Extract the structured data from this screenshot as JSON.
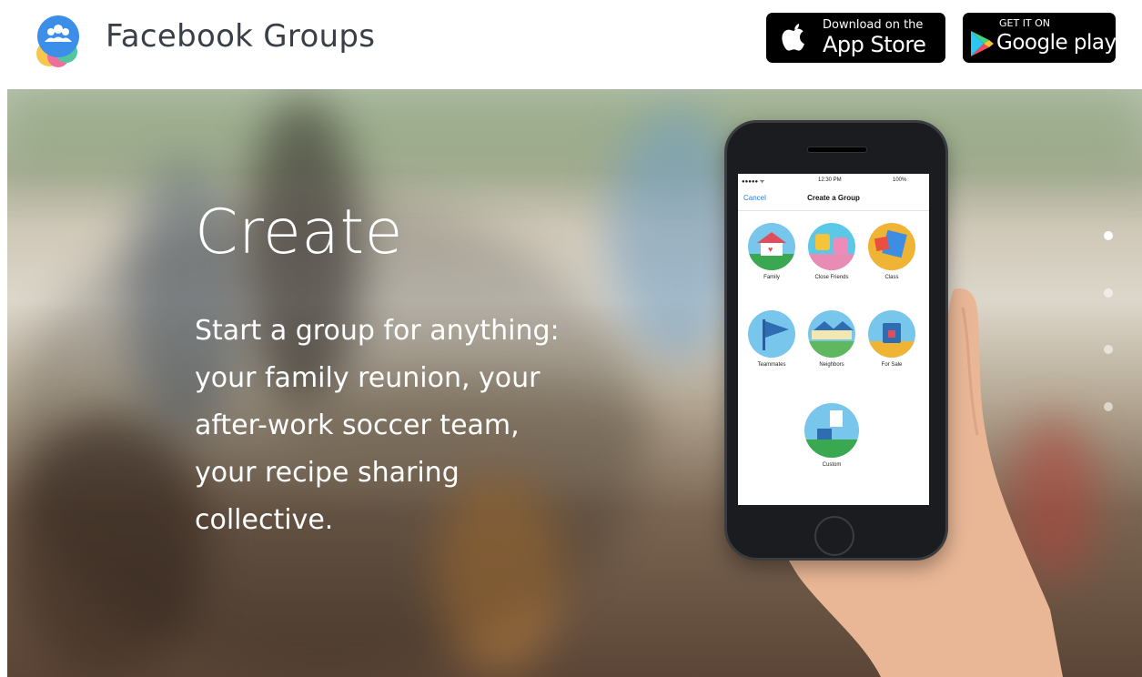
{
  "header": {
    "brand": "Facebook Groups",
    "app_store": {
      "small": "Download on the",
      "big": "App Store",
      "icon": "apple-icon"
    },
    "google_play": {
      "small": "GET IT ON",
      "big": "Google play",
      "icon": "play-triangle-icon"
    }
  },
  "hero": {
    "title": "Create",
    "body": "Start a group for anything: your family reunion, your after-work soccer team, your recipe sharing collective."
  },
  "phone": {
    "time": "12:30 PM",
    "battery": "100%",
    "cancel": "Cancel",
    "nav_title": "Create a Group",
    "tiles": [
      "Family",
      "Close Friends",
      "Class",
      "Teammates",
      "Neighbors",
      "For Sale",
      "Custom"
    ]
  },
  "carousel": {
    "count": 4,
    "active": 0
  },
  "colors": {
    "brand_blue": "#2f7be6",
    "text_dark": "#3a3f47"
  }
}
